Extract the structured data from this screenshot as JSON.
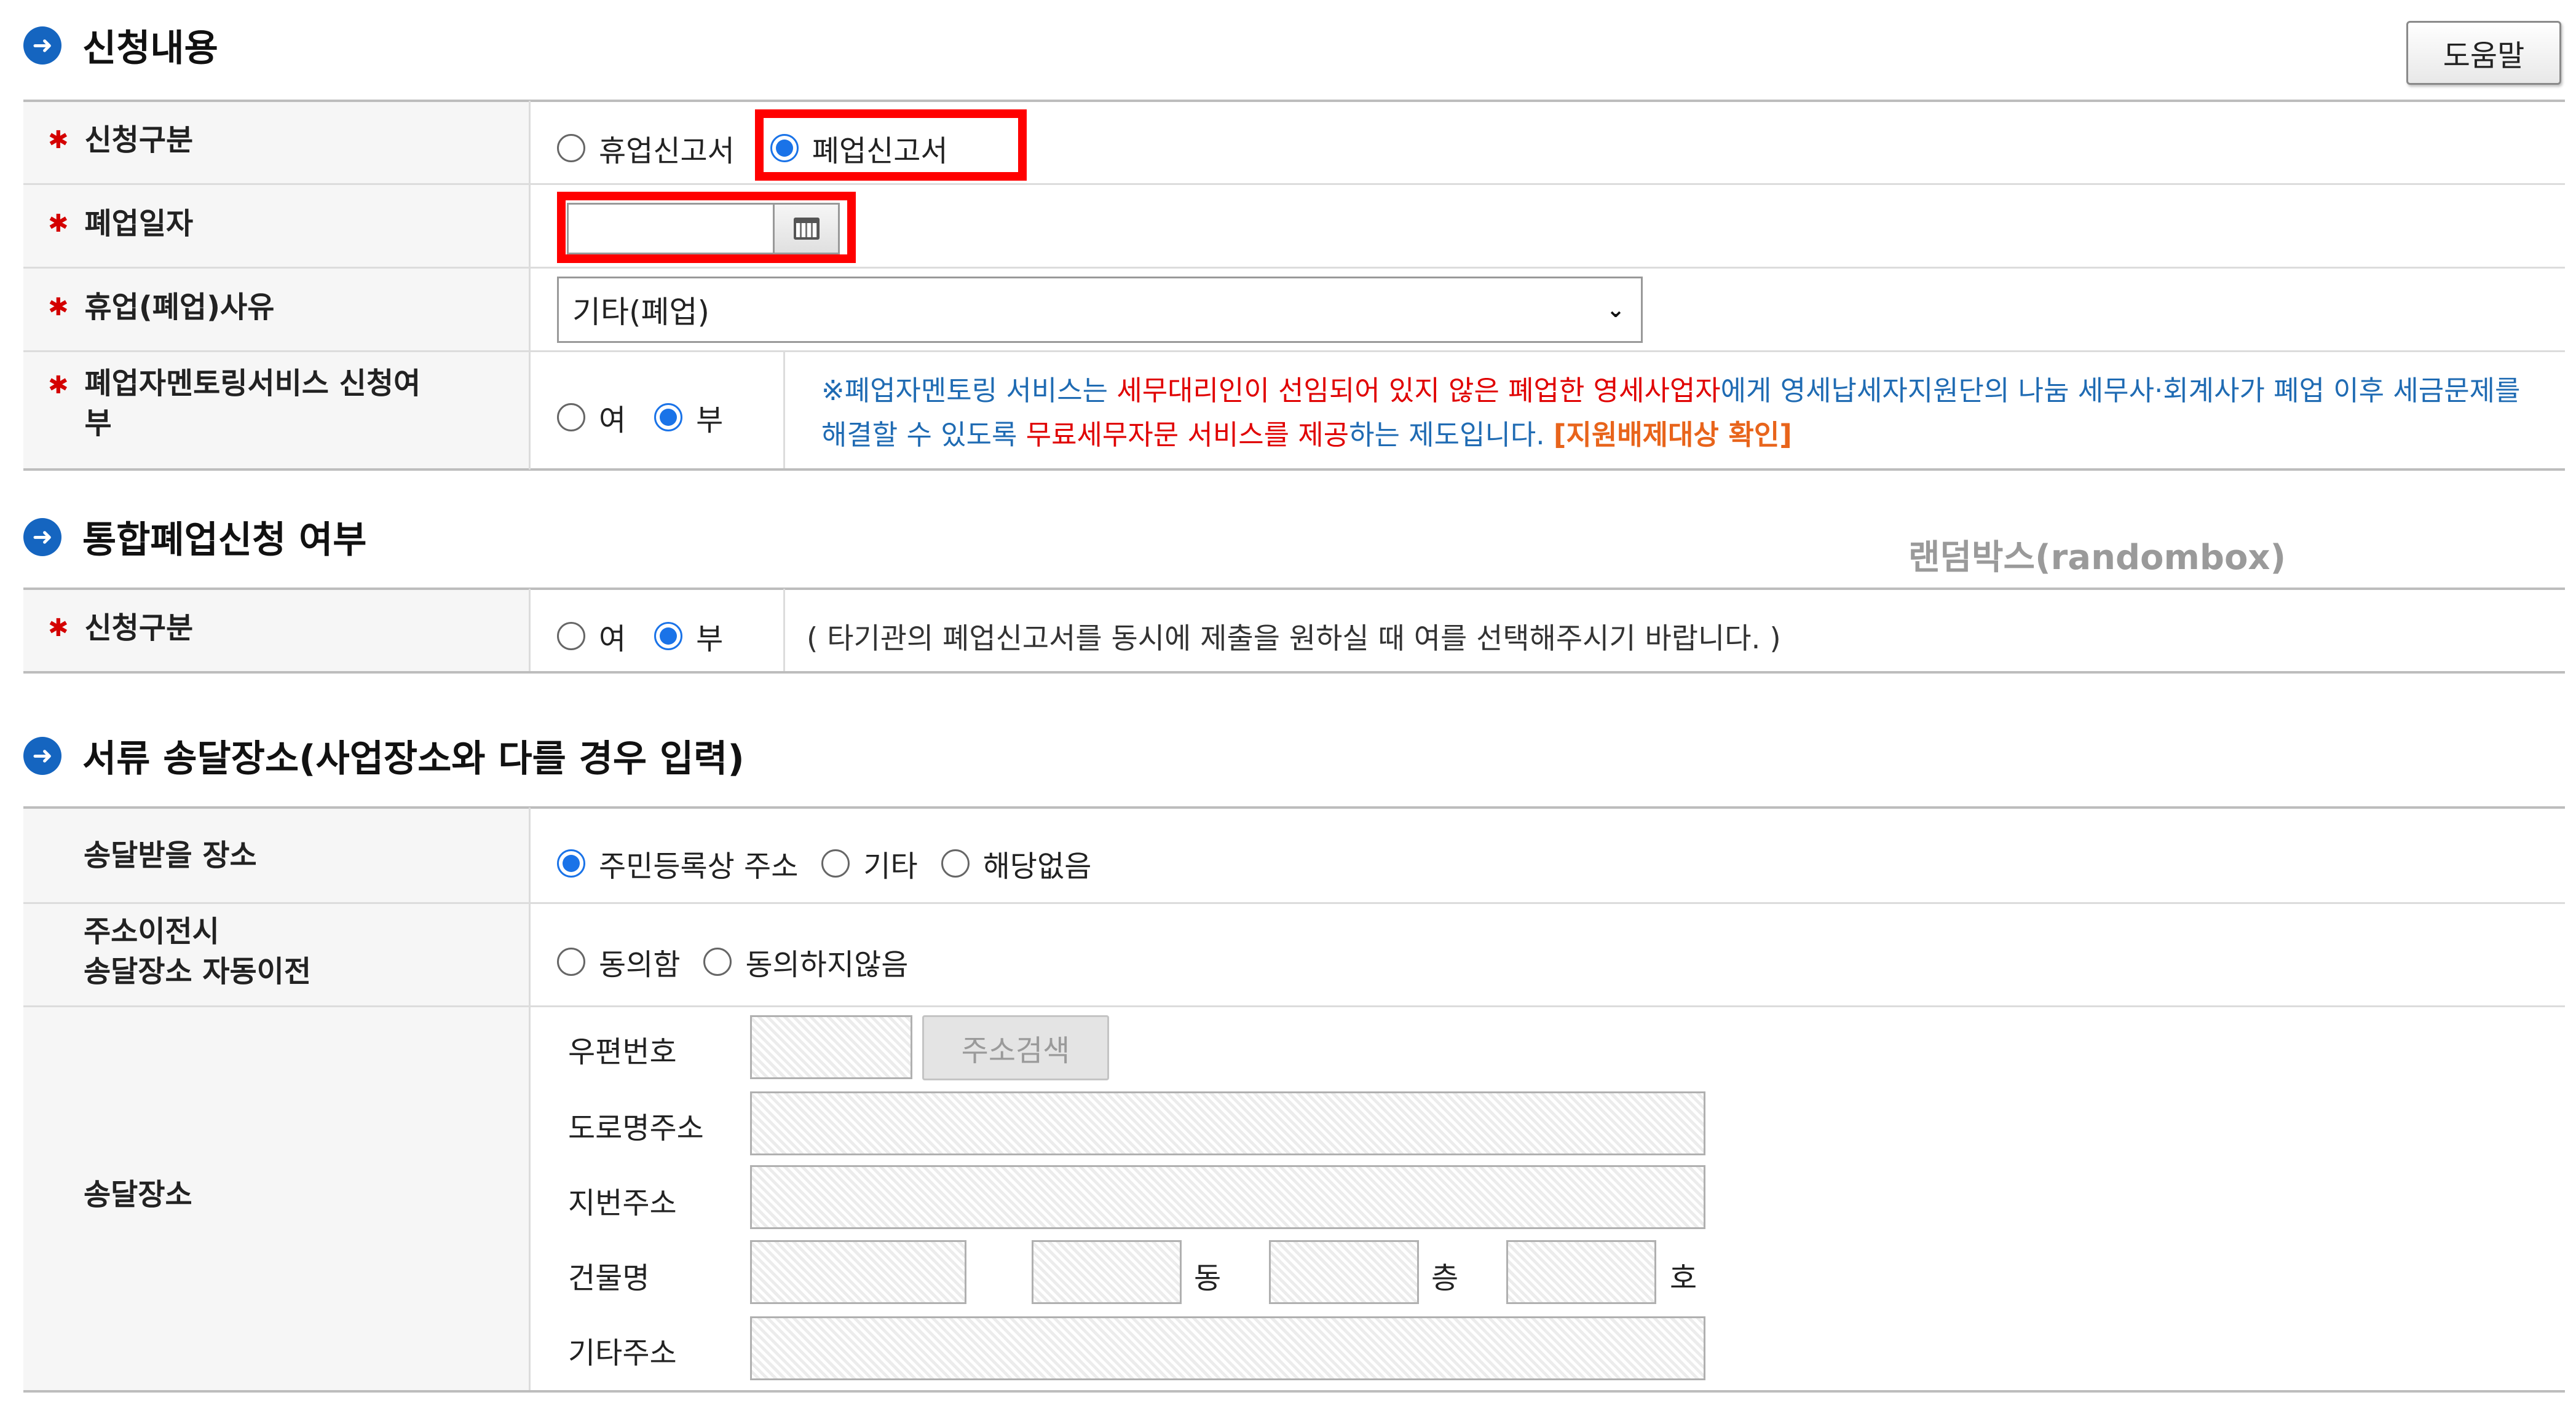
{
  "section1": {
    "title": "신청내용",
    "help_label": "도움말",
    "rows": {
      "type_label": "신청구분",
      "type_options": [
        "휴업신고서",
        "폐업신고서"
      ],
      "type_selected": "폐업신고서",
      "date_label": "폐업일자",
      "date_value": "",
      "reason_label": "휴업(폐업)사유",
      "reason_value": "기타(폐업)",
      "mentoring_label_1": "폐업자멘토링서비스 신청여",
      "mentoring_label_2": "부",
      "mentoring_options": [
        "여",
        "부"
      ],
      "mentoring_selected": "부",
      "mentoring_notice": {
        "p1": "※폐업자멘토링 서비스는 ",
        "p2": "세무대리인이 선임되어 있지 않은 폐업한 영세사업자",
        "p3": "에게 영세납세자지원단의 나눔 세무사·회계사가 폐업 이후 세금문제를 해결할 수 있도록 ",
        "p4": "무료세무자문 서비스를 제공",
        "p5": "하는 제도입니다. ",
        "p6": "[지원배제대상 확인]"
      }
    }
  },
  "section2": {
    "title": "통합폐업신청 여부",
    "watermark": "랜덤박스(randombox)",
    "type_label": "신청구분",
    "options": [
      "여",
      "부"
    ],
    "selected": "부",
    "hint": "( 타기관의 폐업신고서를 동시에 제출을 원하실 때 여를 선택해주시기 바랍니다. )"
  },
  "section3": {
    "title": "서류 송달장소(사업장소와 다를 경우 입력)",
    "place_label": "송달받을 장소",
    "place_options": [
      "주민등록상 주소",
      "기타",
      "해당없음"
    ],
    "place_selected": "주민등록상 주소",
    "auto_move_label_1": "주소이전시",
    "auto_move_label_2": "송달장소 자동이전",
    "auto_move_options": [
      "동의함",
      "동의하지않음"
    ],
    "delivery_label": "송달장소",
    "zip_label": "우편번호",
    "search_button": "주소검색",
    "road_label": "도로명주소",
    "jibun_label": "지번주소",
    "building_label": "건물명",
    "dong_unit": "동",
    "floor_unit": "층",
    "ho_unit": "호",
    "etc_label": "기타주소"
  },
  "colors": {
    "accent_blue": "#1a73e8",
    "bullet_blue": "#1565c0",
    "required_red": "#d40000",
    "highlight_red": "#ff0000",
    "notice_blue": "#1f6bb3",
    "notice_orange": "#e8641b"
  },
  "icons": [
    "arrow-bullet-icon",
    "calendar-icon",
    "chevron-down-icon",
    "required-star-icon"
  ]
}
